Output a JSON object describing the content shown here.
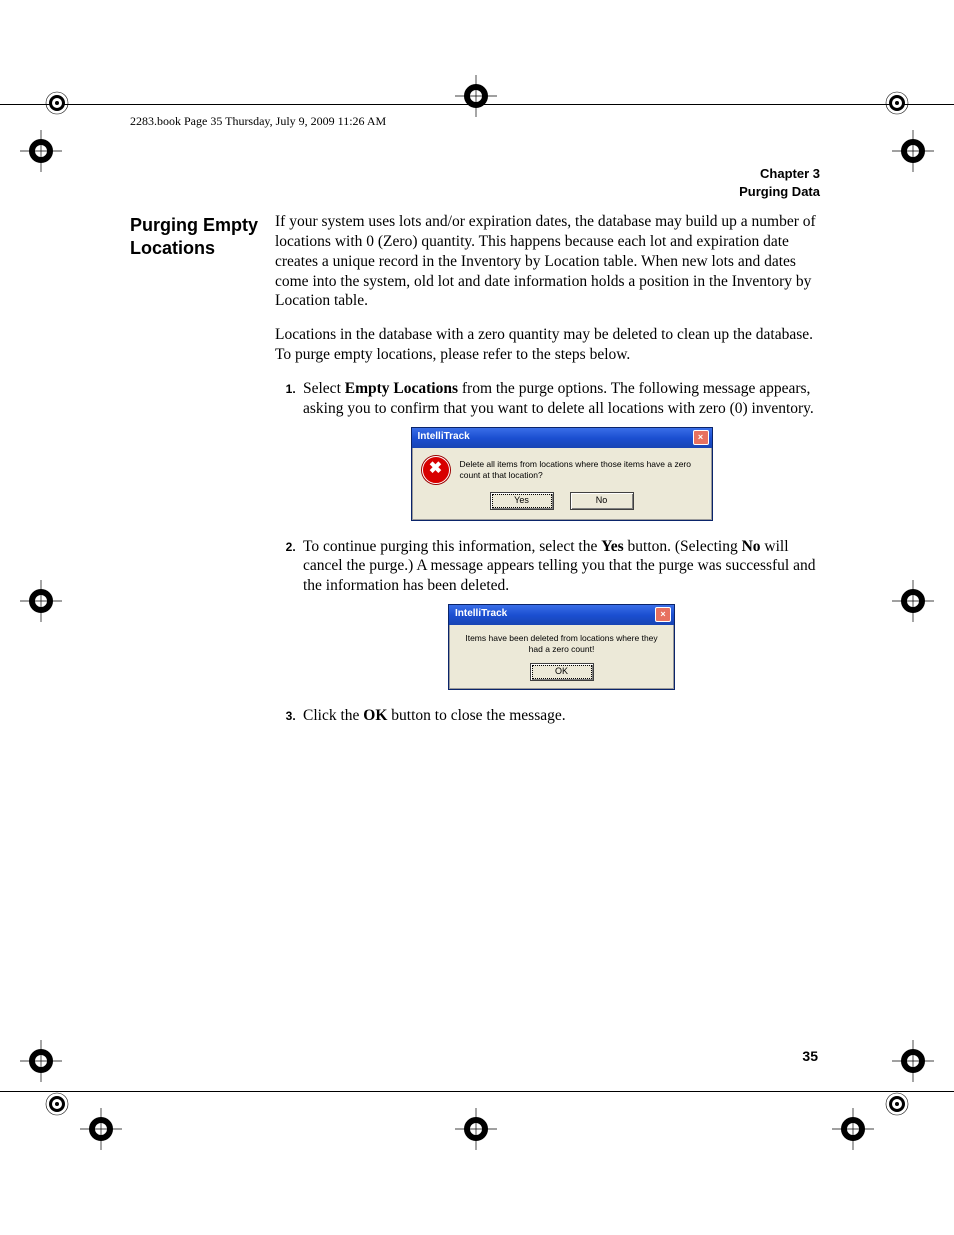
{
  "header": {
    "running_text": "2283.book  Page 35  Thursday, July 9, 2009  11:26 AM"
  },
  "chapter": {
    "line1": "Chapter 3",
    "line2": "Purging Data"
  },
  "section_heading": "Purging Empty Locations",
  "paragraphs": {
    "p1": "If your system uses lots and/or expiration dates, the database may build up a number of locations with 0 (Zero) quantity. This happens because each lot and expiration date creates a unique record in the Inventory by Location table. When new lots and dates come into the system, old lot and date information holds a position in the Inventory by Location table.",
    "p2": "Locations in the database with a zero quantity may be deleted to clean up the database. To purge empty locations, please refer to the steps below."
  },
  "steps": {
    "s1_pre": "Select ",
    "s1_bold": "Empty Locations",
    "s1_post": " from the purge options. The following message appears, asking you to confirm that you want to delete all locations with zero (0) inventory.",
    "s2_pre": "To continue purging this information, select the ",
    "s2_bold1": "Yes",
    "s2_mid": " button. (Selecting ",
    "s2_bold2": "No",
    "s2_post": " will cancel the purge.) A message appears telling you that the purge was successful and the information has been deleted.",
    "s3_pre": "Click the ",
    "s3_bold": "OK",
    "s3_post": " button to close the message."
  },
  "dialog1": {
    "title": "IntelliTrack",
    "message": "Delete all items from locations where those items have a zero count at that location?",
    "btn_yes": "Yes",
    "btn_no": "No",
    "close_x": "×"
  },
  "dialog2": {
    "title": "IntelliTrack",
    "message": "Items have been deleted from locations where they had a zero count!",
    "btn_ok": "OK",
    "close_x": "×"
  },
  "page_number": "35"
}
